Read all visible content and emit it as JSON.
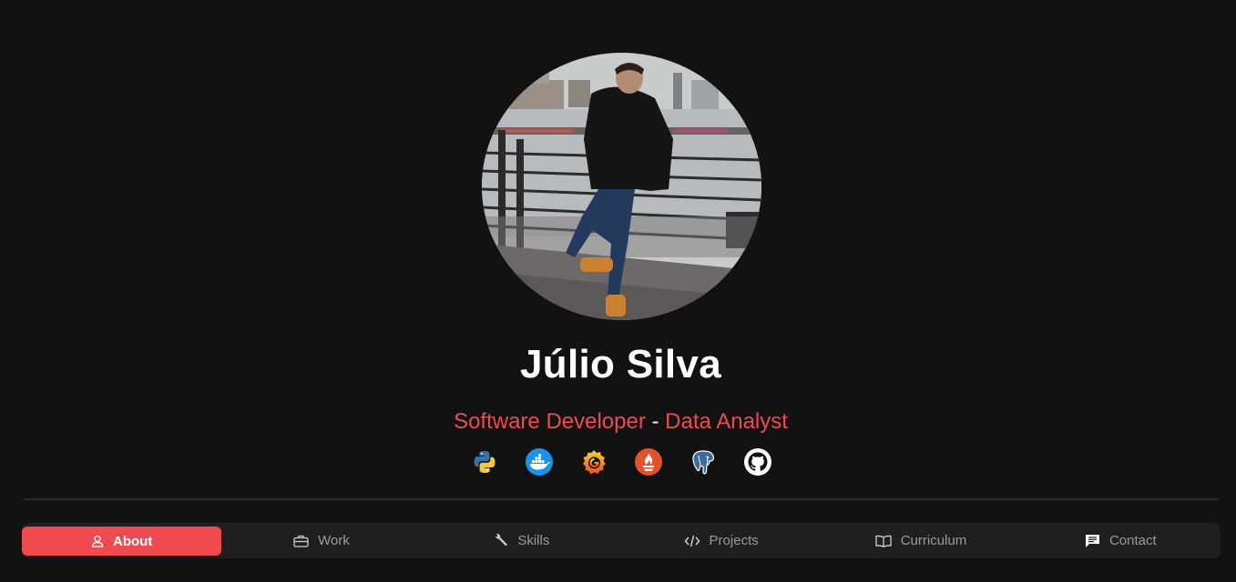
{
  "profile": {
    "name": "Júlio Silva",
    "role_primary": "Software Developer",
    "separator": " - ",
    "role_secondary": "Data Analyst",
    "photo_alt": "Júlio Silva portrait"
  },
  "tech_icons": [
    {
      "icon": "python-icon",
      "label": "Python"
    },
    {
      "icon": "docker-icon",
      "label": "Docker"
    },
    {
      "icon": "grafana-icon",
      "label": "Grafana"
    },
    {
      "icon": "prometheus-icon",
      "label": "Prometheus"
    },
    {
      "icon": "postgresql-icon",
      "label": "PostgreSQL"
    },
    {
      "icon": "github-icon",
      "label": "GitHub"
    }
  ],
  "nav": {
    "tabs": [
      {
        "label": "About",
        "icon": "user-icon",
        "active": true
      },
      {
        "label": "Work",
        "icon": "briefcase-icon",
        "active": false
      },
      {
        "label": "Skills",
        "icon": "wrench-icon",
        "active": false
      },
      {
        "label": "Projects",
        "icon": "code-icon",
        "active": false
      },
      {
        "label": "Curriculum",
        "icon": "book-icon",
        "active": false
      },
      {
        "label": "Contact",
        "icon": "chat-icon",
        "active": false
      }
    ]
  },
  "colors": {
    "background": "#121212",
    "accent": "#ef4a4f",
    "nav_background": "#1f1f1f",
    "nav_text": "#9a9a9a"
  }
}
